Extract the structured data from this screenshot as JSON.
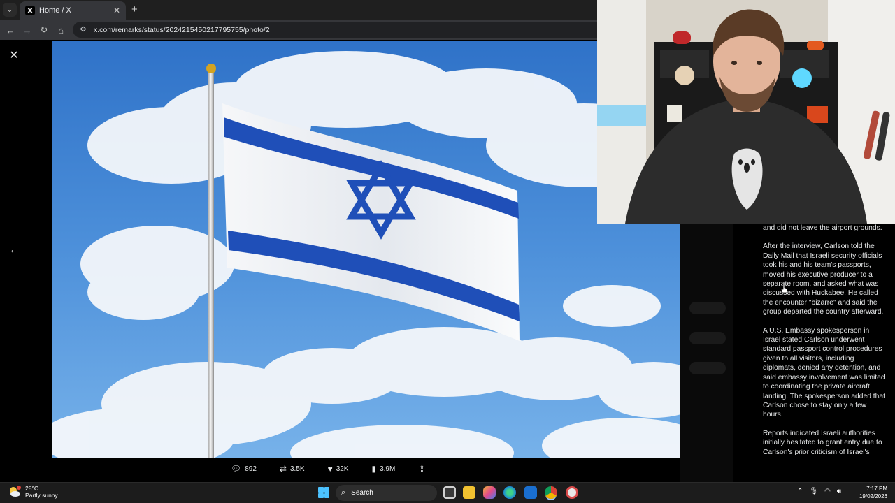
{
  "browser": {
    "tab_title": "Home / X",
    "tab_favicon": "X",
    "url": "x.com/remarks/status/2024215450217795755/photo/2"
  },
  "post_actions": {
    "replies": "892",
    "reposts": "3.5K",
    "likes": "32K",
    "views": "3.9M"
  },
  "article": {
    "paragraphs": [
      "and did not leave the airport grounds.",
      "After the interview, Carlson told the Daily Mail that Israeli security officials took his and his team's passports, moved his executive producer to a separate room, and asked what was discussed with Huckabee. He called the encounter \"bizarre\" and said the group departed the country afterward.",
      "A U.S. Embassy spokesperson in Israel stated Carlson underwent standard passport control procedures given to all visitors, including diplomats, denied any detention, and said embassy involvement was limited to coordinating the private aircraft landing. The spokesperson added that Carlson chose to stay only a few hours.",
      "Reports indicated Israeli authorities initially hesitated to grant entry due to Carlson's prior criticism of Israel's"
    ]
  },
  "taskbar": {
    "weather_temp": "28°C",
    "weather_desc": "Partly sunny",
    "search_placeholder": "Search",
    "time": "7:17 PM",
    "date": "19/02/2026"
  },
  "colors": {
    "flag_blue": "#1f4fb8",
    "sky": "#5a9be0",
    "windows_accent": "#4cc2ff"
  }
}
